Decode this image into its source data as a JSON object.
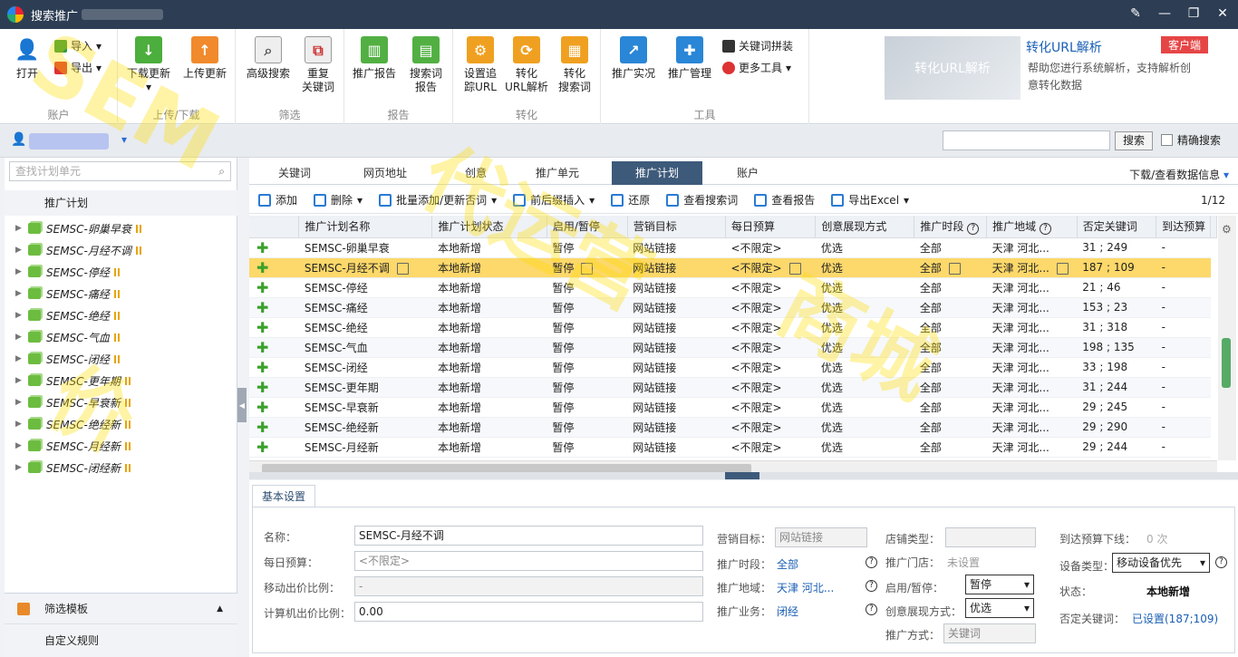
{
  "window": {
    "title": "搜索推广"
  },
  "ribbon": {
    "account": {
      "open": "打开",
      "import": "导入",
      "export": "导出",
      "label": "账户"
    },
    "updown": {
      "download": "下载更新",
      "upload": "上传更新",
      "label": "上传/下载"
    },
    "filter": {
      "advanced": "高级搜索",
      "dup1": "重复",
      "dup2": "关键词",
      "label": "筛选"
    },
    "report": {
      "promo": "推广报告",
      "search1": "搜索词",
      "search2": "报告",
      "label": "报告"
    },
    "convert": {
      "track1": "设置追",
      "track2": "踪URL",
      "url1": "转化",
      "url2": "URL解析",
      "sw1": "转化",
      "sw2": "搜索词",
      "label": "转化"
    },
    "tools": {
      "live": "推广实况",
      "manage": "推广管理",
      "kw": "关键词拼装",
      "more": "更多工具",
      "label": "工具"
    },
    "promo": {
      "image_text": "转化URL解析",
      "title": "转化URL解析",
      "desc": "帮助您进行系统解析，支持解析创意转化数据",
      "badge": "客户端"
    }
  },
  "search": {
    "button": "搜索",
    "precise": "精确搜索"
  },
  "left": {
    "search_placeholder": "查找计划单元",
    "header": "推广计划",
    "items": [
      "SEMSC-卵巢早衰",
      "SEMSC-月经不调",
      "SEMSC-停经",
      "SEMSC-痛经",
      "SEMSC-绝经",
      "SEMSC-气血",
      "SEMSC-闭经",
      "SEMSC-更年期",
      "SEMSC-早衰新",
      "SEMSC-绝经新",
      "SEMSC-月经新",
      "SEMSC-闭经新"
    ],
    "filter_template": "筛选模板",
    "custom_rule": "自定义规则"
  },
  "tabs": [
    "关键词",
    "网页地址",
    "创意",
    "推广单元",
    "推广计划",
    "账户"
  ],
  "download_info": "下载/查看数据信息",
  "toolbar": {
    "add": "添加",
    "del": "删除",
    "batch": "批量添加/更新否词",
    "insert": "前后缀插入",
    "restore": "还原",
    "view_search": "查看搜索词",
    "view_report": "查看报告",
    "export": "导出Excel",
    "page": "1/12"
  },
  "columns": [
    "推广计划名称",
    "推广计划状态",
    "启用/暂停",
    "营销目标",
    "每日预算",
    "创意展现方式",
    "推广时段",
    "推广地域",
    "否定关键词",
    "到达预算"
  ],
  "rows": [
    [
      "SEMSC-卵巢早衰",
      "本地新增",
      "暂停",
      "网站链接",
      "<不限定>",
      "优选",
      "全部",
      "天津 河北...",
      "31 ; 249",
      "-"
    ],
    [
      "SEMSC-月经不调",
      "本地新增",
      "暂停",
      "网站链接",
      "<不限定>",
      "优选",
      "全部",
      "天津 河北...",
      "187 ; 109",
      "-"
    ],
    [
      "SEMSC-停经",
      "本地新增",
      "暂停",
      "网站链接",
      "<不限定>",
      "优选",
      "全部",
      "天津 河北...",
      "21 ; 46",
      "-"
    ],
    [
      "SEMSC-痛经",
      "本地新增",
      "暂停",
      "网站链接",
      "<不限定>",
      "优选",
      "全部",
      "天津 河北...",
      "153 ; 23",
      "-"
    ],
    [
      "SEMSC-绝经",
      "本地新增",
      "暂停",
      "网站链接",
      "<不限定>",
      "优选",
      "全部",
      "天津 河北...",
      "31 ; 318",
      "-"
    ],
    [
      "SEMSC-气血",
      "本地新增",
      "暂停",
      "网站链接",
      "<不限定>",
      "优选",
      "全部",
      "天津 河北...",
      "198 ; 135",
      "-"
    ],
    [
      "SEMSC-闭经",
      "本地新增",
      "暂停",
      "网站链接",
      "<不限定>",
      "优选",
      "全部",
      "天津 河北...",
      "33 ; 198",
      "-"
    ],
    [
      "SEMSC-更年期",
      "本地新增",
      "暂停",
      "网站链接",
      "<不限定>",
      "优选",
      "全部",
      "天津 河北...",
      "31 ; 244",
      "-"
    ],
    [
      "SEMSC-早衰新",
      "本地新增",
      "暂停",
      "网站链接",
      "<不限定>",
      "优选",
      "全部",
      "天津 河北...",
      "29 ; 245",
      "-"
    ],
    [
      "SEMSC-绝经新",
      "本地新增",
      "暂停",
      "网站链接",
      "<不限定>",
      "优选",
      "全部",
      "天津 河北...",
      "29 ; 290",
      "-"
    ],
    [
      "SEMSC-月经新",
      "本地新增",
      "暂停",
      "网站链接",
      "<不限定>",
      "优选",
      "全部",
      "天津 河北...",
      "29 ; 244",
      "-"
    ]
  ],
  "detail": {
    "tab": "基本设置",
    "name_label": "名称：",
    "name": "SEMSC-月经不调",
    "budget_label": "每日预算：",
    "budget_ph": "<不限定>",
    "mobile_label": "移动出价比例：",
    "mobile": "-",
    "pc_label": "计算机出价比例：",
    "pc": "0.00",
    "goal_label": "营销目标：",
    "goal": "网站链接",
    "time_label": "推广时段：",
    "time": "全部",
    "region_label": "推广地域：",
    "region": "天津 河北...",
    "biz_label": "推广业务：",
    "biz": "闭经",
    "shop_label": "店铺类型：",
    "store_label": "推广门店：",
    "store": "未设置",
    "status_label": "启用/暂停：",
    "status": "暂停",
    "show_label": "创意展现方式：",
    "show": "优选",
    "way_label": "推广方式：",
    "way": "关键词",
    "reach_label": "到达预算下线：",
    "reach": "0 次",
    "device_label": "设备类型：",
    "device": "移动设备优先",
    "state_label": "状态：",
    "state": "本地新增",
    "neg_label": "否定关键词：",
    "neg": "已设置(187;109)"
  },
  "watermark": [
    "SEM",
    "代运营",
    "商城",
    "价"
  ]
}
